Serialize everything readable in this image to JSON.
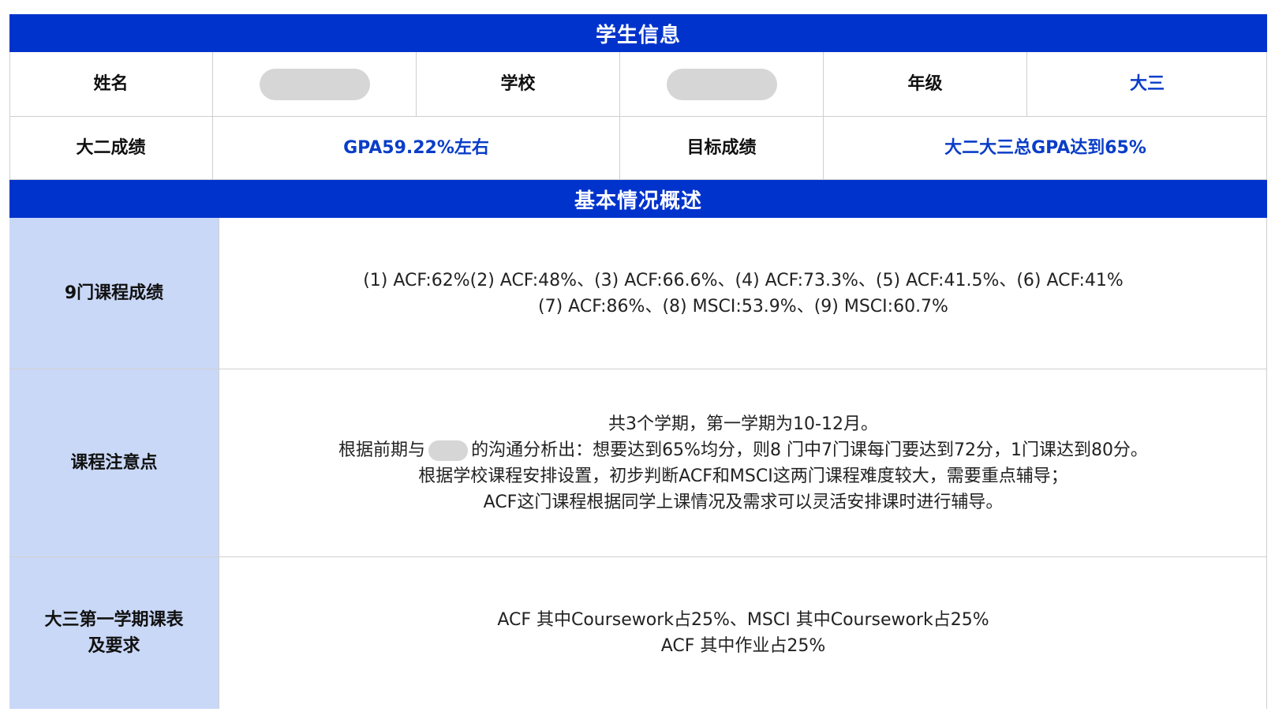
{
  "colors": {
    "header_bg": "#0033cc",
    "sidebar_bg": "#c9d8f7",
    "value_blue": "#0a3dc8"
  },
  "section_student_info": {
    "title": "学生信息",
    "row1": {
      "name_label": "姓名",
      "school_label": "学校",
      "grade_label": "年级",
      "grade_value": "大三"
    },
    "row2": {
      "sophomore_label": "大二成绩",
      "sophomore_value": "GPA59.22%左右",
      "target_label": "目标成绩",
      "target_value": "大二大三总GPA达到65%"
    }
  },
  "section_overview": {
    "title": "基本情况概述",
    "rows": [
      {
        "label": "9门课程成绩",
        "lines": [
          "(1) ACF:62%(2) ACF:48%、(3) ACF:66.6%、(4) ACF:73.3%、(5) ACF:41.5%、(6) ACF:41%",
          "(7) ACF:86%、(8) MSCI:53.9%、(9) MSCI:60.7%"
        ]
      },
      {
        "label": "课程注意点",
        "line1": "共3个学期，第一学期为10-12月。",
        "line2_prefix": "根据前期与",
        "line2_suffix": "的沟通分析出：想要达到65%均分，则8 门中7门课每门要达到72分，1门课达到80分。",
        "line3": "根据学校课程安排设置，初步判断ACF和MSCI这两门课程难度较大，需要重点辅导；",
        "line4": "ACF这门课程根据同学上课情况及需求可以灵活安排课时进行辅导。"
      },
      {
        "label_line1": "大三第一学期课表",
        "label_line2": "及要求",
        "lines": [
          "ACF 其中Coursework占25%、MSCI 其中Coursework占25%",
          "ACF 其中作业占25%"
        ]
      }
    ]
  }
}
